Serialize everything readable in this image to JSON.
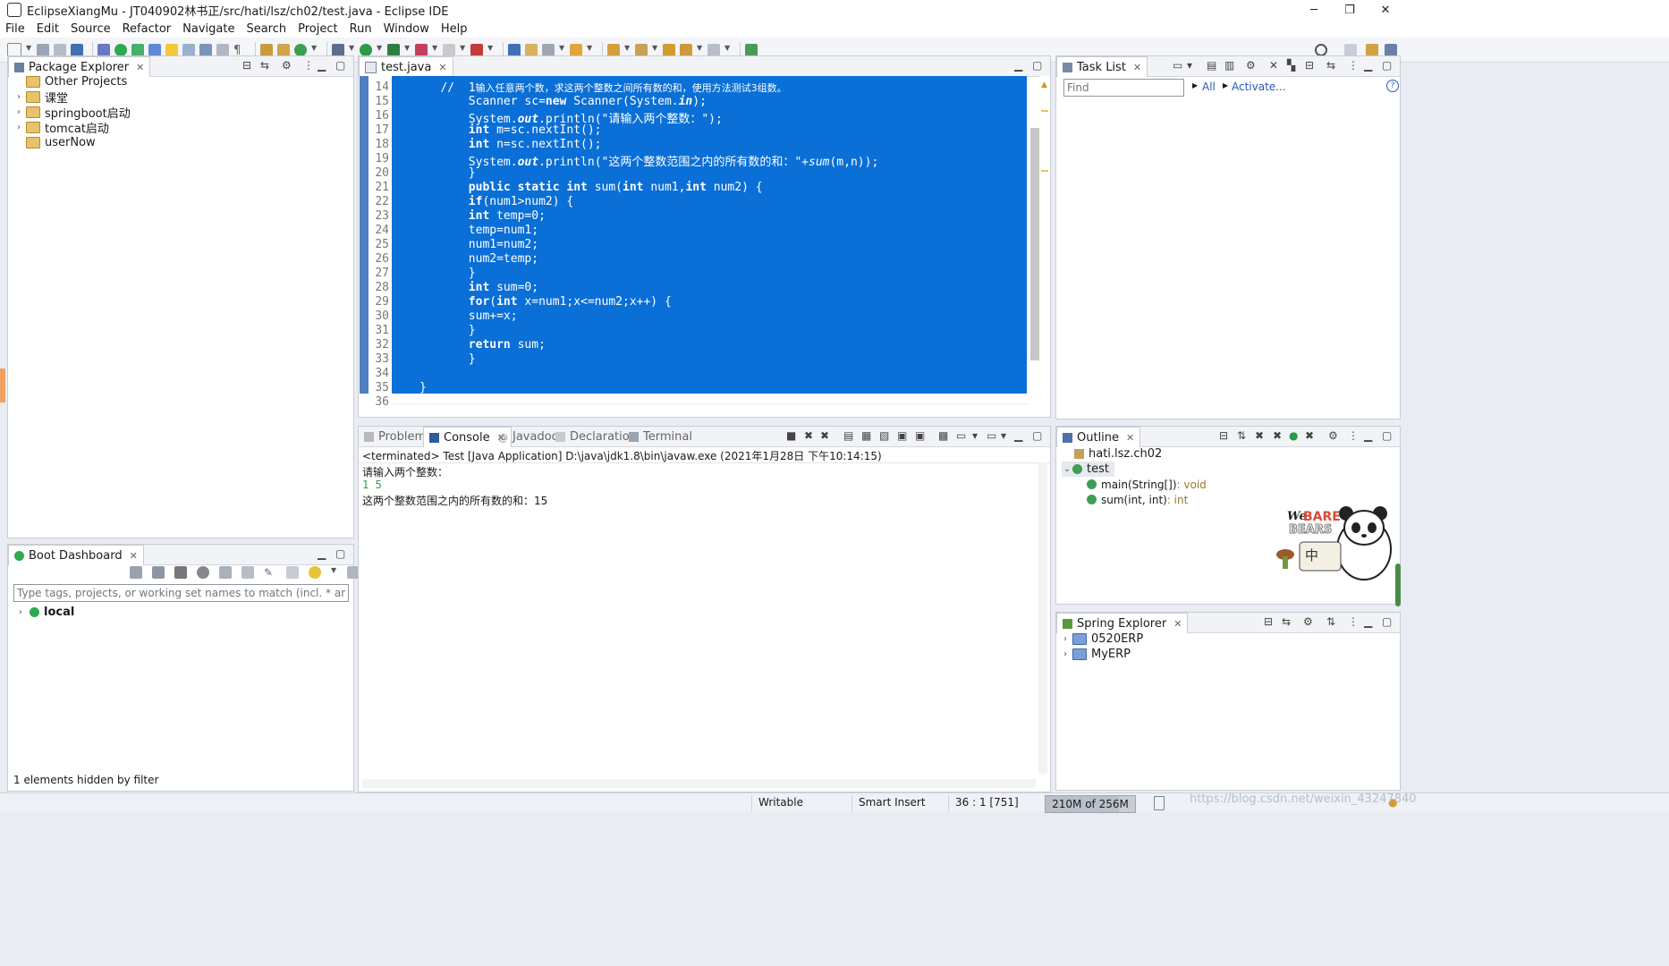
{
  "window": {
    "title": "EclipseXiangMu - JT040902林书正/src/hati/lsz/ch02/test.java - Eclipse IDE",
    "minimize": "─",
    "restore": "❐",
    "close": "✕"
  },
  "menubar": [
    "File",
    "Edit",
    "Source",
    "Refactor",
    "Navigate",
    "Search",
    "Project",
    "Run",
    "Window",
    "Help"
  ],
  "package_explorer": {
    "tab_label": "Package Explorer",
    "items": [
      {
        "label": "Other Projects",
        "expandable": false
      },
      {
        "label": "课堂",
        "expandable": true
      },
      {
        "label": "springboot启动",
        "expandable": true
      },
      {
        "label": "tomcat启动",
        "expandable": true
      },
      {
        "label": "userNow",
        "expandable": false
      }
    ]
  },
  "boot_dashboard": {
    "tab_label": "Boot Dashboard",
    "filter_placeholder": "Type tags, projects, or working set names to match (incl. * and ? wildcards)",
    "items": [
      {
        "label": "local"
      }
    ],
    "footer": "1 elements hidden by filter"
  },
  "editor": {
    "tab_label": "test.java",
    "lines": [
      {
        "n": "14",
        "t": "//  1输入任意两个数，求这两个整数之间所有数的和，使用方法测试3组数。",
        "indent": "   "
      },
      {
        "n": "15",
        "t": "Scanner sc=new Scanner(System.in);",
        "indent": "       "
      },
      {
        "n": "16",
        "t": "System.out.println(\"请输入两个整数：\");",
        "indent": "       "
      },
      {
        "n": "17",
        "t": "int m=sc.nextInt();",
        "indent": "       "
      },
      {
        "n": "18",
        "t": "int n=sc.nextInt();",
        "indent": "       "
      },
      {
        "n": "19",
        "t": "System.out.println(\"这两个整数范围之内的所有数的和：\"+sum(m,n));",
        "indent": "       "
      },
      {
        "n": "20",
        "t": "}",
        "indent": "       "
      },
      {
        "n": "21",
        "t": "public static int sum(int num1,int num2) {",
        "indent": "       "
      },
      {
        "n": "22",
        "t": "if(num1>num2) {",
        "indent": "       "
      },
      {
        "n": "23",
        "t": "int temp=0;",
        "indent": "       "
      },
      {
        "n": "24",
        "t": "temp=num1;",
        "indent": "       "
      },
      {
        "n": "25",
        "t": "num1=num2;",
        "indent": "       "
      },
      {
        "n": "26",
        "t": "num2=temp;",
        "indent": "       "
      },
      {
        "n": "27",
        "t": "}",
        "indent": "       "
      },
      {
        "n": "28",
        "t": "int sum=0;",
        "indent": "       "
      },
      {
        "n": "29",
        "t": "for(int x=num1;x<=num2;x++) {",
        "indent": "       "
      },
      {
        "n": "30",
        "t": "sum+=x;",
        "indent": "       "
      },
      {
        "n": "31",
        "t": "}",
        "indent": "       "
      },
      {
        "n": "32",
        "t": "return sum;",
        "indent": "       "
      },
      {
        "n": "33",
        "t": "}",
        "indent": "       "
      },
      {
        "n": "34",
        "t": "",
        "indent": ""
      },
      {
        "n": "35",
        "t": "}",
        "indent": ""
      },
      {
        "n": "36",
        "t": "",
        "indent": ""
      }
    ]
  },
  "task_list": {
    "tab_label": "Task List",
    "find_placeholder": "Find",
    "all_label": "All",
    "activate_label": "Activate..."
  },
  "bottom_tabs": {
    "problems": "Problems",
    "console": "Console",
    "javadoc": "Javadoc",
    "declaration": "Declaration",
    "terminal": "Terminal"
  },
  "console": {
    "header": "<terminated> Test [Java Application] D:\\java\\jdk1.8\\bin\\javaw.exe (2021年1月28日 下午10:14:15)",
    "lines": [
      {
        "text": "请输入两个整数：",
        "kind": "out"
      },
      {
        "text": "1 5",
        "kind": "in"
      },
      {
        "text": "这两个整数范围之内的所有数的和：15",
        "kind": "out"
      }
    ]
  },
  "outline": {
    "tab_label": "Outline",
    "package": "hati.lsz.ch02",
    "class": "test",
    "members": [
      {
        "name": "main(String[])",
        "type": " : void"
      },
      {
        "name": "sum(int, int)",
        "type": " : int"
      }
    ]
  },
  "spring_explorer": {
    "tab_label": "Spring Explorer",
    "items": [
      "0520ERP",
      "MyERP"
    ]
  },
  "status": {
    "writable": "Writable",
    "insert_mode": "Smart Insert",
    "position": "36 : 1 [751]",
    "heap": "210M of 256M",
    "heap_fraction": 0.82
  },
  "watermark": "https://blog.csdn.net/weixin_43247840",
  "decoration": {
    "logo_text_1": "We",
    "logo_text_2": "BARE",
    "logo_text_3": "BEARS",
    "sign_text": "中"
  },
  "colors": {
    "selection": "#0a6fd6",
    "accent": "#4f7ec2",
    "link": "#2a57b7",
    "console_input": "#2f9a4b"
  }
}
